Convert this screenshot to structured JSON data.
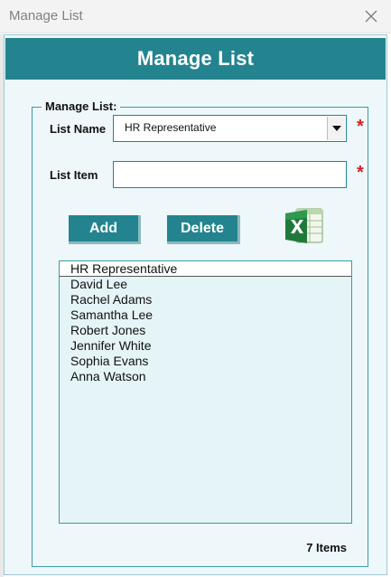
{
  "window": {
    "title": "Manage List",
    "close_icon": "close-icon"
  },
  "form": {
    "header_title": "Manage List",
    "group_label": "Manage List:",
    "list_name_label": "List Name",
    "list_name_value": "HR Representative",
    "list_item_label": "List Item",
    "list_item_value": "",
    "required_mark": "*",
    "add_label": "Add",
    "delete_label": "Delete",
    "excel_icon": "excel-icon",
    "items": [
      "HR Representative",
      "David Lee",
      "Rachel Adams",
      "Samantha Lee",
      "Robert Jones",
      "Jennifer White",
      "Sophia Evans",
      "Anna Watson"
    ],
    "items_count": "7 Items"
  },
  "colors": {
    "accent": "#23848f",
    "form_background": "#eef7fa",
    "list_background": "#e5f4f7",
    "required": "#d62020"
  }
}
